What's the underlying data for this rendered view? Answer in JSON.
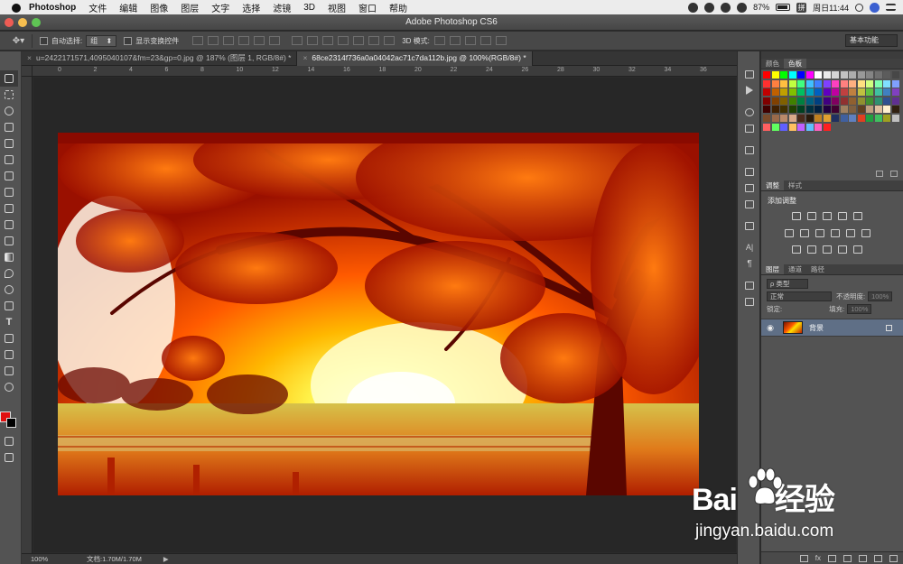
{
  "macbar": {
    "app": "Photoshop",
    "menus": [
      "文件",
      "编辑",
      "图像",
      "图层",
      "文字",
      "选择",
      "滤镜",
      "3D",
      "视图",
      "窗口",
      "帮助"
    ],
    "battery": "87%",
    "ime": "拼",
    "clock": "周日11:44"
  },
  "window": {
    "title": "Adobe Photoshop CS6"
  },
  "options": {
    "auto_select_label": "自动选择:",
    "auto_select_value": "组",
    "show_transform_label": "显示变换控件",
    "mode_3d_label": "3D 模式:",
    "workspace": "基本功能"
  },
  "tabs": [
    {
      "label": "u=2422171571,4095040107&fm=23&gp=0.jpg @ 187% (图层 1, RGB/8#) *",
      "close": "×"
    },
    {
      "label": "68ce2314f736a0a04042ac71c7da112b.jpg @ 100%(RGB/8#) *",
      "close": "×"
    }
  ],
  "ruler": {
    "ticks": [
      "0",
      "2",
      "4",
      "6",
      "8",
      "10",
      "12",
      "14",
      "16",
      "18",
      "20",
      "22",
      "24",
      "26",
      "28",
      "30",
      "32",
      "34",
      "36"
    ]
  },
  "status": {
    "zoom": "100%",
    "doc": "文档:1.70M/1.70M",
    "arrow": "▶"
  },
  "panels": {
    "color_tabs": [
      "颜色",
      "色板"
    ],
    "adjust_tabs": [
      "调整",
      "样式"
    ],
    "adjust_title": "添加调整",
    "layer_tabs": [
      "图层",
      "通道",
      "路径"
    ],
    "kind": "ρ 类型",
    "blend_mode": "正常",
    "opacity_label": "不透明度:",
    "opacity_value": "100%",
    "lock_label": "锁定:",
    "fill_label": "填充:",
    "fill_value": "100%",
    "layer_name": "背景",
    "fx": "fx"
  },
  "watermark": {
    "line1": "Bai",
    "line1b": "经验",
    "line2": "jingyan.baidu.com"
  },
  "colors": {
    "fg": "#e01010",
    "bg": "#000000",
    "selected_layer": "#5f6f86"
  }
}
